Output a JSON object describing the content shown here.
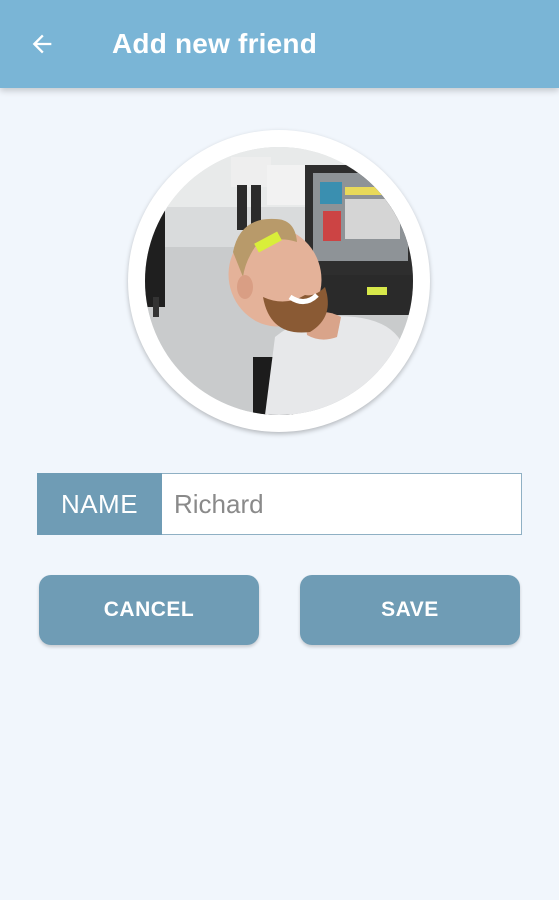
{
  "app_bar": {
    "title": "Add new friend",
    "back_icon": "arrow-left-icon",
    "background": "#7ab5d6"
  },
  "avatar": {
    "description_icon": "profile-photo"
  },
  "form": {
    "name_label": "NAME",
    "name_value": "Richard"
  },
  "actions": {
    "cancel_label": "CANCEL",
    "save_label": "SAVE",
    "button_color": "#6f9cb5"
  }
}
